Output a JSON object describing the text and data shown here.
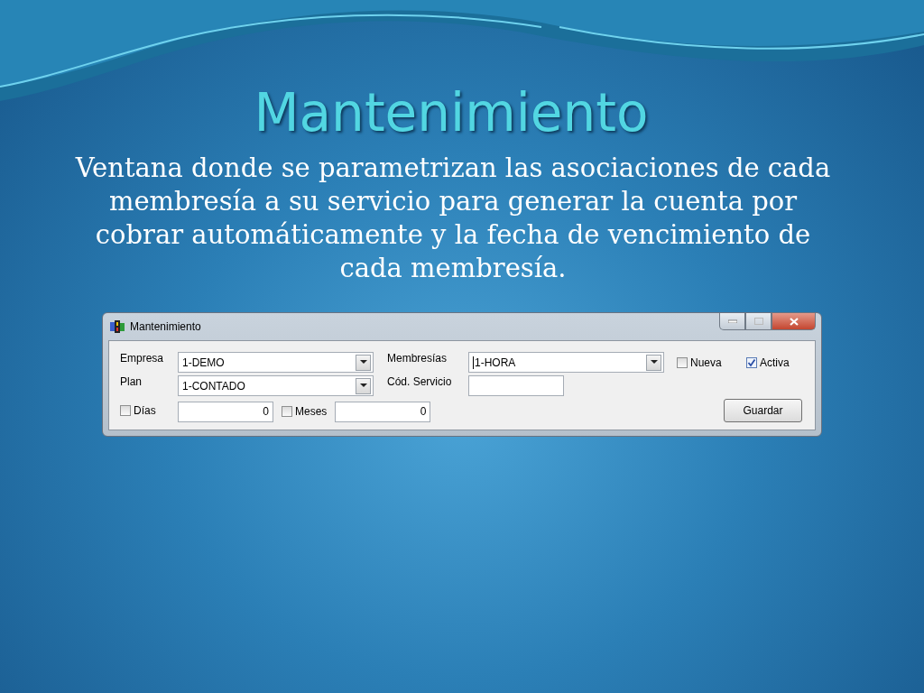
{
  "slide": {
    "title": "Mantenimiento",
    "description": "Ventana donde se parametrizan las asociaciones de cada membresía a su servicio para generar la cuenta por cobrar automáticamente y la fecha de vencimiento de cada membresía."
  },
  "window": {
    "title": "Mantenimiento"
  },
  "empresa": {
    "label": "Empresa",
    "value": "1-DEMO"
  },
  "plan": {
    "label": "Plan",
    "value": "1-CONTADO"
  },
  "membresias": {
    "label": "Membresías",
    "value": "1-HORA",
    "focused": true
  },
  "cod_servicio": {
    "label": "Cód. Servicio"
  },
  "nueva": {
    "label": "Nueva",
    "checked": false
  },
  "activa": {
    "label": "Activa",
    "checked": true
  },
  "dias": {
    "label": "Días",
    "checked": false,
    "value": "0"
  },
  "meses": {
    "label": "Meses",
    "checked": false,
    "value": "0"
  },
  "buttons": [
    {
      "label": "Guardar"
    }
  ]
}
